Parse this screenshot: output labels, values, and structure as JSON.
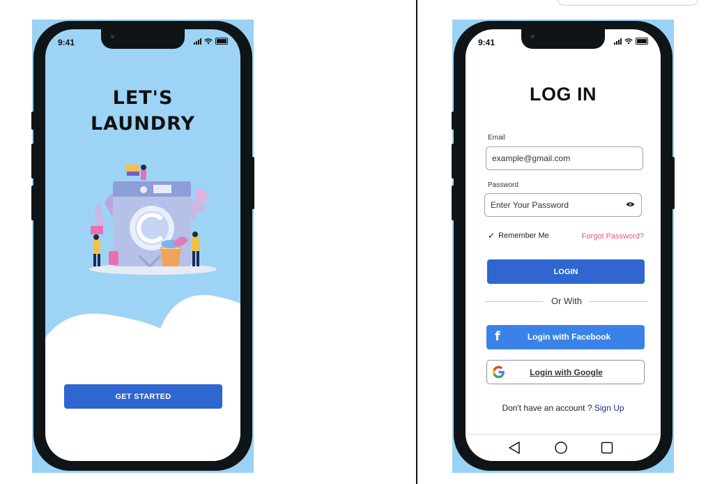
{
  "status_bar": {
    "time": "9:41"
  },
  "welcome_screen": {
    "title_line1": "LET'S",
    "title_line2": "LAUNDRY",
    "cta_label": "GET STARTED"
  },
  "login_screen": {
    "title": "LOG IN",
    "email_label": "Email",
    "email_placeholder": "example@gmail.com",
    "password_label": "Password",
    "password_placeholder": "Enter Your Password",
    "remember_label": "Remember Me",
    "remember_checked": true,
    "forgot_label": "Forgot Password?",
    "login_label": "LOGIN",
    "divider_label": "Or With",
    "facebook_label": "Login with Facebook",
    "google_label": "Login with Google",
    "signup_prompt": "Don't have an account ?",
    "signup_link": "Sign Up"
  },
  "colors": {
    "accent_blue": "#2f66cf",
    "facebook_blue": "#3b82e8",
    "background_blue": "#99d2f4",
    "forgot_red": "#e05a6b"
  },
  "icons": [
    "facebook-icon",
    "google-icon",
    "eye-icon",
    "check-icon",
    "back-nav-icon",
    "home-nav-icon",
    "recents-nav-icon"
  ]
}
